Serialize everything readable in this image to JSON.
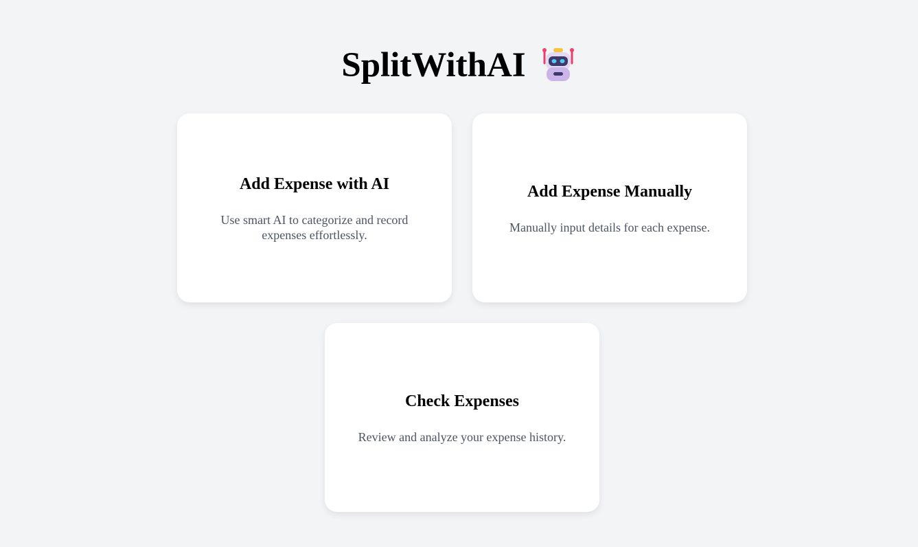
{
  "header": {
    "title": "SplitWithAI",
    "emoji_icon": "robot-icon"
  },
  "cards": [
    {
      "title": "Add Expense with AI",
      "description": "Use smart AI to categorize and record expenses effortlessly."
    },
    {
      "title": "Add Expense Manually",
      "description": "Manually input details for each expense."
    },
    {
      "title": "Check Expenses",
      "description": "Review and analyze your expense history."
    }
  ],
  "colors": {
    "background": "#f3f4f6",
    "card": "#ffffff",
    "title_text": "#000000",
    "description_text": "#4b5563"
  }
}
